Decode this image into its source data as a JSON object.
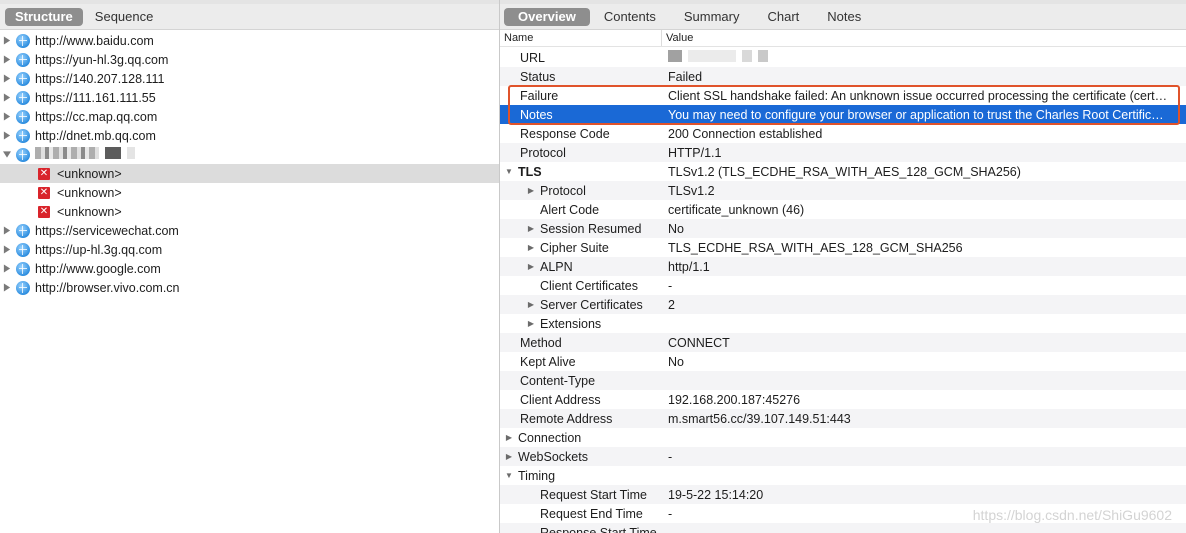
{
  "left": {
    "segments": [
      {
        "label": "Structure",
        "active": true
      },
      {
        "label": "Sequence",
        "active": false
      }
    ],
    "tree": [
      {
        "label": "http://www.baidu.com",
        "icon": "globe-icon",
        "level": 0,
        "expanded": false
      },
      {
        "label": "https://yun-hl.3g.qq.com",
        "icon": "globe-icon",
        "level": 0,
        "expanded": false
      },
      {
        "label": "https://140.207.128.111",
        "icon": "globe-icon",
        "level": 0,
        "expanded": false
      },
      {
        "label": "https://111.161.111.55",
        "icon": "globe-icon",
        "level": 0,
        "expanded": false
      },
      {
        "label": "https://cc.map.qq.com",
        "icon": "globe-icon",
        "level": 0,
        "expanded": false
      },
      {
        "label": "http://dnet.mb.qq.com",
        "icon": "globe-icon",
        "level": 0,
        "expanded": false
      },
      {
        "label": "",
        "icon": "globe-icon",
        "level": 0,
        "expanded": true,
        "redacted": true
      },
      {
        "label": "<unknown>",
        "icon": "error-icon",
        "level": 1,
        "selected": true
      },
      {
        "label": "<unknown>",
        "icon": "error-icon",
        "level": 1
      },
      {
        "label": "<unknown>",
        "icon": "error-icon",
        "level": 1
      },
      {
        "label": "https://servicewechat.com",
        "icon": "globe-icon",
        "level": 0,
        "expanded": false
      },
      {
        "label": "https://up-hl.3g.qq.com",
        "icon": "globe-icon",
        "level": 0,
        "expanded": false
      },
      {
        "label": "http://www.google.com",
        "icon": "globe-icon",
        "level": 0,
        "expanded": false
      },
      {
        "label": "http://browser.vivo.com.cn",
        "icon": "globe-icon",
        "level": 0,
        "expanded": false
      }
    ]
  },
  "right": {
    "tabs": [
      {
        "label": "Overview",
        "active": true
      },
      {
        "label": "Contents",
        "active": false
      },
      {
        "label": "Summary",
        "active": false
      },
      {
        "label": "Chart",
        "active": false
      },
      {
        "label": "Notes",
        "active": false
      }
    ],
    "columns": {
      "name": "Name",
      "value": "Value"
    },
    "rows": [
      {
        "name": "URL",
        "value": "",
        "indent": 1,
        "redacted": true
      },
      {
        "name": "Status",
        "value": "Failed",
        "indent": 1
      },
      {
        "name": "Failure",
        "value": "Client SSL handshake failed: An unknown issue occurred processing the certificate (cert…",
        "indent": 1
      },
      {
        "name": "Notes",
        "value": "You may need to configure your browser or application to trust the Charles Root Certific…",
        "indent": 1,
        "selected": true
      },
      {
        "name": "Response Code",
        "value": "200 Connection established",
        "indent": 1
      },
      {
        "name": "Protocol",
        "value": "HTTP/1.1",
        "indent": 1
      },
      {
        "name": "TLS",
        "value": "TLSv1.2 (TLS_ECDHE_RSA_WITH_AES_128_GCM_SHA256)",
        "indent": 0,
        "toggle": "open",
        "bold": true
      },
      {
        "name": "Protocol",
        "value": "TLSv1.2",
        "indent": 2,
        "toggle": "closed"
      },
      {
        "name": "Alert Code",
        "value": "certificate_unknown (46)",
        "indent": 2
      },
      {
        "name": "Session Resumed",
        "value": "No",
        "indent": 2,
        "toggle": "closed"
      },
      {
        "name": "Cipher Suite",
        "value": "TLS_ECDHE_RSA_WITH_AES_128_GCM_SHA256",
        "indent": 2,
        "toggle": "closed"
      },
      {
        "name": "ALPN",
        "value": "http/1.1",
        "indent": 2,
        "toggle": "closed"
      },
      {
        "name": "Client Certificates",
        "value": "-",
        "indent": 2
      },
      {
        "name": "Server Certificates",
        "value": "2",
        "indent": 2,
        "toggle": "closed"
      },
      {
        "name": "Extensions",
        "value": "",
        "indent": 2,
        "toggle": "closed"
      },
      {
        "name": "Method",
        "value": "CONNECT",
        "indent": 1
      },
      {
        "name": "Kept Alive",
        "value": "No",
        "indent": 1
      },
      {
        "name": "Content-Type",
        "value": "",
        "indent": 1
      },
      {
        "name": "Client Address",
        "value": "192.168.200.187:45276",
        "indent": 1
      },
      {
        "name": "Remote Address",
        "value": "m.smart56.cc/39.107.149.51:443",
        "indent": 1
      },
      {
        "name": "Connection",
        "value": "",
        "indent": 0,
        "toggle": "closed"
      },
      {
        "name": "WebSockets",
        "value": "-",
        "indent": 0,
        "toggle": "closed"
      },
      {
        "name": "Timing",
        "value": "",
        "indent": 0,
        "toggle": "open"
      },
      {
        "name": "Request Start Time",
        "value": "19-5-22 15:14:20",
        "indent": 2
      },
      {
        "name": "Request End Time",
        "value": "-",
        "indent": 2
      },
      {
        "name": "Response Start Time",
        "value": "",
        "indent": 2
      }
    ]
  },
  "watermark": "https://blog.csdn.net/ShiGu9602",
  "colors": {
    "selection": "#1a69d6",
    "highlight_border": "#e0532b",
    "active_tab": "#8e8e8e",
    "error_icon": "#d9242b"
  }
}
